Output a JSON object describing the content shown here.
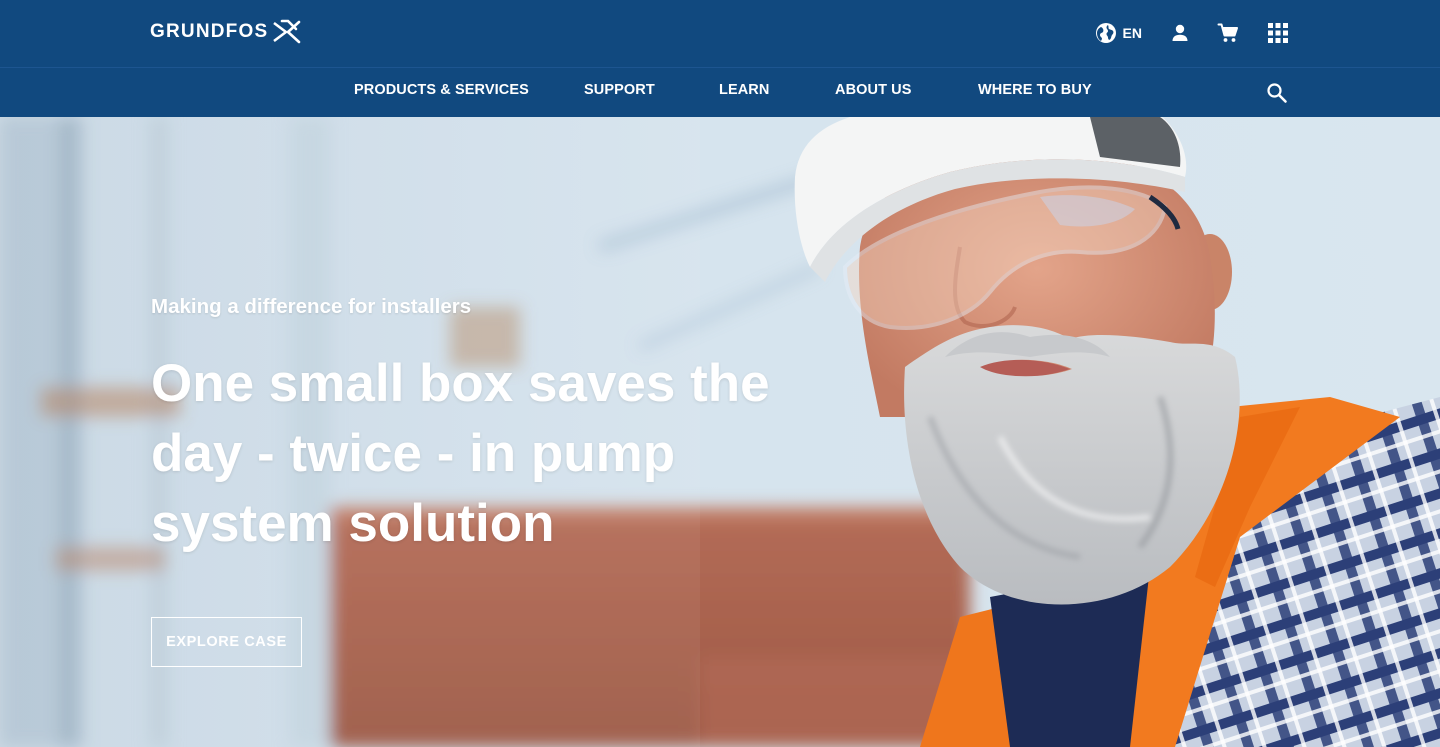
{
  "brand": {
    "name": "GRUNDFOS"
  },
  "utility": {
    "language_code": "EN",
    "icons": [
      "globe-icon",
      "user-icon",
      "cart-icon",
      "apps-grid-icon"
    ]
  },
  "nav": {
    "items": [
      {
        "label": "PRODUCTS & SERVICES"
      },
      {
        "label": "SUPPORT"
      },
      {
        "label": "LEARN"
      },
      {
        "label": "ABOUT US"
      },
      {
        "label": "WHERE TO BUY"
      }
    ],
    "search_icon": "search-icon"
  },
  "hero": {
    "eyebrow": "Making a difference for installers",
    "headline": "One small box saves the day - twice - in pump system solution",
    "cta_label": "EXPLORE CASE"
  },
  "colors": {
    "header_bg": "#11497f",
    "text_on_dark": "#ffffff"
  }
}
